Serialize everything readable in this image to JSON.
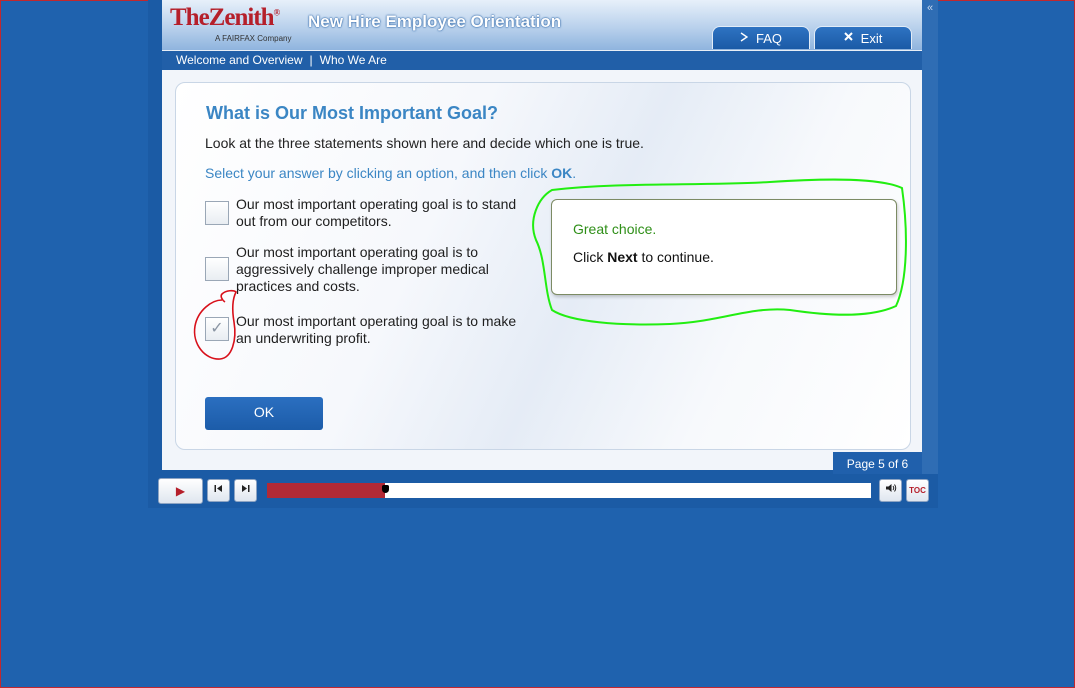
{
  "header": {
    "logo_text": "TheZenith",
    "logo_reg": "®",
    "logo_sub": "A FAIRFAX Company",
    "course_title": "New Hire Employee Orientation",
    "faq_label": "FAQ",
    "exit_label": "Exit",
    "collapse_glyph": "«"
  },
  "breadcrumb": {
    "item1": "Welcome and Overview",
    "separator": "|",
    "item2": "Who We Are"
  },
  "question": {
    "title": "What is Our Most Important Goal?",
    "instruction": "Look at the three statements shown here and decide which one is true.",
    "prompt_prefix": "Select your answer by clicking an option, and then click ",
    "prompt_ok": "OK",
    "prompt_suffix": ".",
    "options": [
      {
        "text": "Our most important operating goal is to stand out from our competitors.",
        "checked": false
      },
      {
        "text": "Our most important operating goal is to aggressively challenge improper medical practices and costs.",
        "checked": false
      },
      {
        "text": "Our most important operating goal is to make an underwriting profit.",
        "checked": true
      }
    ],
    "check_glyph": "✓",
    "ok_button": "OK"
  },
  "feedback": {
    "title": "Great choice.",
    "body_prefix": "Click ",
    "body_bold": "Next",
    "body_suffix": " to continue."
  },
  "pagination": {
    "label": "Page 5 of 6"
  },
  "player": {
    "play_glyph": "▶",
    "prev_glyph": "⏮",
    "next_glyph": "⏭",
    "volume_glyph": "🔊",
    "toc_label": "TOC",
    "progress_fraction": 0.195
  },
  "colors": {
    "background": "#1f62ae",
    "accent_blue": "#3b86c4",
    "brand_red": "#b51f2a",
    "feedback_green": "#2f8f18",
    "annotation_green": "#22ee11",
    "annotation_red": "#d8101a"
  },
  "icons": [
    "collapse-icon",
    "play-arrow-icon",
    "close-x-icon",
    "checkmark-icon",
    "play-icon",
    "skip-back-icon",
    "skip-forward-icon",
    "volume-icon"
  ]
}
